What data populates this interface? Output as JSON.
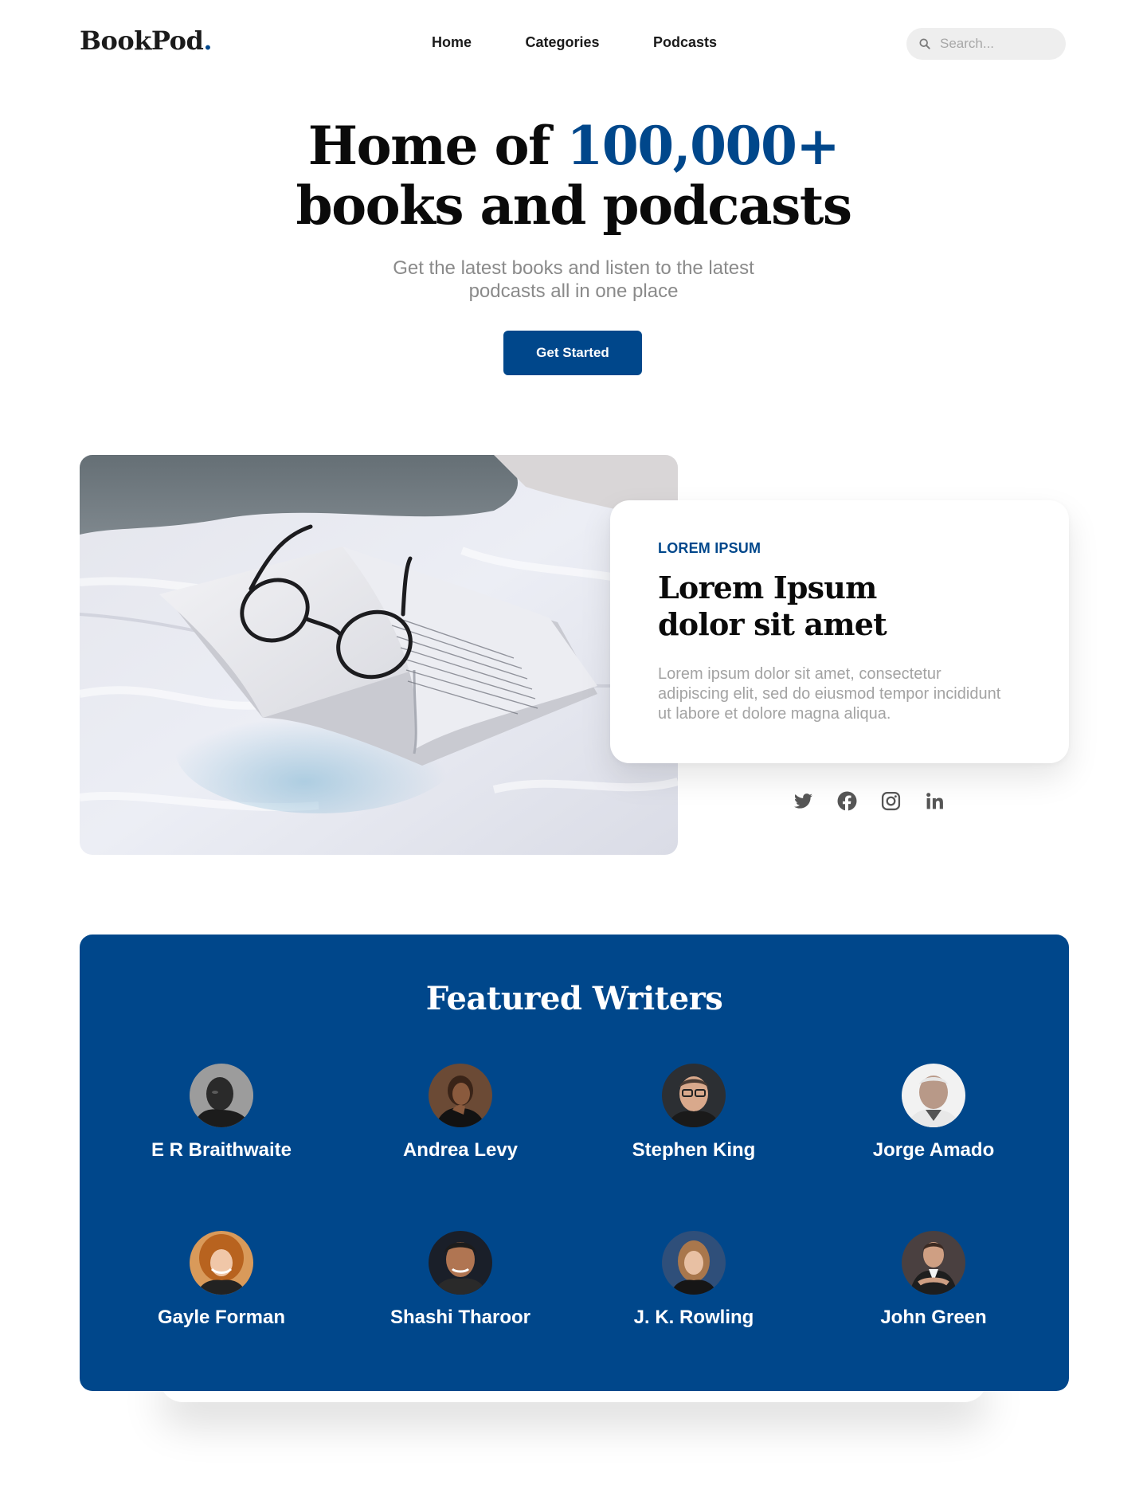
{
  "brand": {
    "name": "BookPod",
    "dot": ".",
    "accent_color": "#00478b"
  },
  "nav": {
    "items": [
      {
        "label": "Home"
      },
      {
        "label": "Categories"
      },
      {
        "label": "Podcasts"
      }
    ]
  },
  "search": {
    "placeholder": "Search...",
    "icon": "search-icon"
  },
  "hero": {
    "title_prefix": "Home of ",
    "title_accent": "100,000+",
    "title_line2": "books and podcasts",
    "subtitle": "Get the latest books and listen to the latest podcasts all in one place",
    "cta_label": "Get Started"
  },
  "feature": {
    "kicker": "LOREM IPSUM",
    "title": "Lorem Ipsum dolor sit amet",
    "body": "Lorem ipsum dolor sit amet, consectetur adipiscing elit, sed do eiusmod tempor incididunt ut labore et dolore magna aliqua.",
    "image": "open-book-with-glasses-on-bed"
  },
  "socials": [
    "twitter-icon",
    "facebook-icon",
    "instagram-icon",
    "linkedin-icon"
  ],
  "writers": {
    "title": "Featured Writers",
    "items": [
      {
        "name": "E R Braithwaite"
      },
      {
        "name": "Andrea Levy"
      },
      {
        "name": "Stephen King"
      },
      {
        "name": "Jorge Amado"
      },
      {
        "name": "Gayle Forman"
      },
      {
        "name": "Shashi Tharoor"
      },
      {
        "name": "J. K. Rowling"
      },
      {
        "name": "John Green"
      }
    ]
  }
}
